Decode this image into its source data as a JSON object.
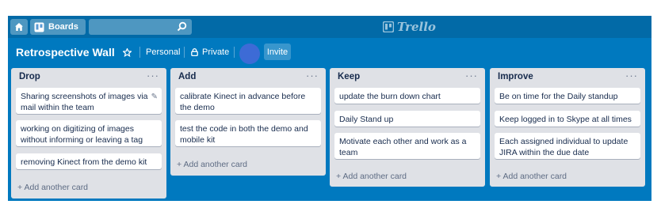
{
  "topbar": {
    "home_icon": "home-icon",
    "boards_label": "Boards",
    "search": {
      "value": "",
      "icon": "search-icon"
    },
    "logo_text": "Trello"
  },
  "board": {
    "title": "Retrospective Wall",
    "star_icon": "star-icon",
    "team_label": "Personal",
    "visibility_label": "Private",
    "visibility_icon": "lock-icon",
    "invite_label": "Invite",
    "background_color": "#0079bf"
  },
  "lists": [
    {
      "title": "Drop",
      "menu": "···",
      "cards": [
        "Sharing screenshots of images via mail within the team",
        "working on digitizing of images without informing or leaving a tag",
        "removing Kinect from the demo kit"
      ],
      "add_label": "+ Add another card"
    },
    {
      "title": "Add",
      "menu": "···",
      "cards": [
        "calibrate Kinect in advance before the demo",
        "test the code in both the demo and mobile kit"
      ],
      "add_label": "+ Add another card"
    },
    {
      "title": "Keep",
      "menu": "···",
      "cards": [
        "update the burn down chart",
        "Daily Stand up",
        "Motivate each other and work as a team"
      ],
      "add_label": "+ Add another card"
    },
    {
      "title": "Improve",
      "menu": "···",
      "cards": [
        "Be on time for the Daily standup",
        "Keep logged in to Skype at all times",
        "Each assigned individual to update JIRA within the due date"
      ],
      "add_label": "+ Add another card"
    }
  ]
}
